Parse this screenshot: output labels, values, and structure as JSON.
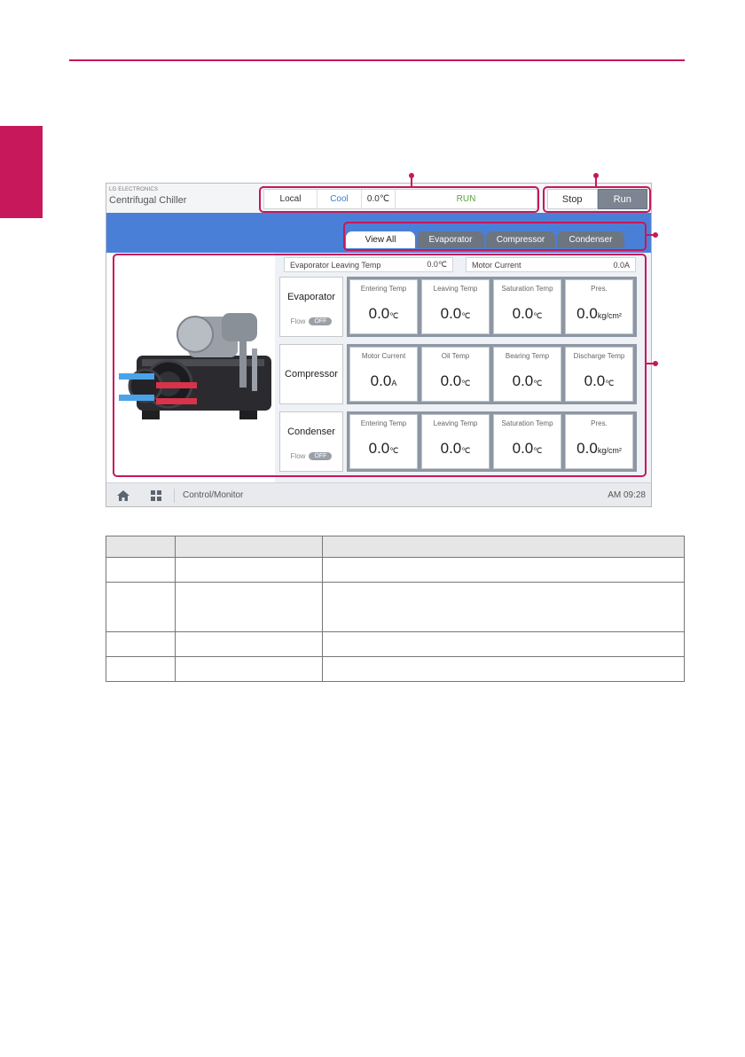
{
  "screen": {
    "brand_small": "LG ELECTRONICS",
    "brand_title": "Centrifugal Chiller",
    "status": {
      "mode": "Local",
      "operation": "Cool",
      "temperature": "0.0℃",
      "run_state": "RUN"
    },
    "controls": {
      "stop_label": "Stop",
      "run_label": "Run"
    },
    "tabs": [
      {
        "label": "View All"
      },
      {
        "label": "Evaporator"
      },
      {
        "label": "Compressor"
      },
      {
        "label": "Condenser"
      }
    ],
    "summary": {
      "evap_leaving_label": "Evaporator Leaving Temp",
      "evap_leaving_value": "0.0℃",
      "motor_current_label": "Motor Current",
      "motor_current_value": "0.0A"
    },
    "sections": [
      {
        "title": "Evaporator",
        "flow_label": "Flow",
        "flow_state": "OFF",
        "cells": [
          {
            "label": "Entering Temp",
            "value": "0.0",
            "unit": "℃"
          },
          {
            "label": "Leaving Temp",
            "value": "0.0",
            "unit": "℃"
          },
          {
            "label": "Saturation Temp",
            "value": "0.0",
            "unit": "℃"
          },
          {
            "label": "Pres.",
            "value": "0.0",
            "unit": "kg/cm²"
          }
        ]
      },
      {
        "title": "Compressor",
        "cells": [
          {
            "label": "Motor Current",
            "value": "0.0",
            "unit": "A"
          },
          {
            "label": "Oil Temp",
            "value": "0.0",
            "unit": "℃"
          },
          {
            "label": "Bearing Temp",
            "value": "0.0",
            "unit": "℃"
          },
          {
            "label": "Discharge Temp",
            "value": "0.0",
            "unit": "℃"
          }
        ]
      },
      {
        "title": "Condenser",
        "flow_label": "Flow",
        "flow_state": "OFF",
        "cells": [
          {
            "label": "Entering Temp",
            "value": "0.0",
            "unit": "℃"
          },
          {
            "label": "Leaving Temp",
            "value": "0.0",
            "unit": "℃"
          },
          {
            "label": "Saturation Temp",
            "value": "0.0",
            "unit": "℃"
          },
          {
            "label": "Pres.",
            "value": "0.0",
            "unit": "kg/cm²"
          }
        ]
      }
    ],
    "footer": {
      "home_icon": "home-icon",
      "menu_icon": "grid-menu-icon",
      "breadcrumb": "Control/Monitor",
      "clock": "AM 09:28"
    }
  },
  "colors": {
    "accent": "#c6185a",
    "header_blue": "#4a7fd8",
    "run_green": "#57a53d",
    "cool_blue": "#3a7fd0"
  }
}
